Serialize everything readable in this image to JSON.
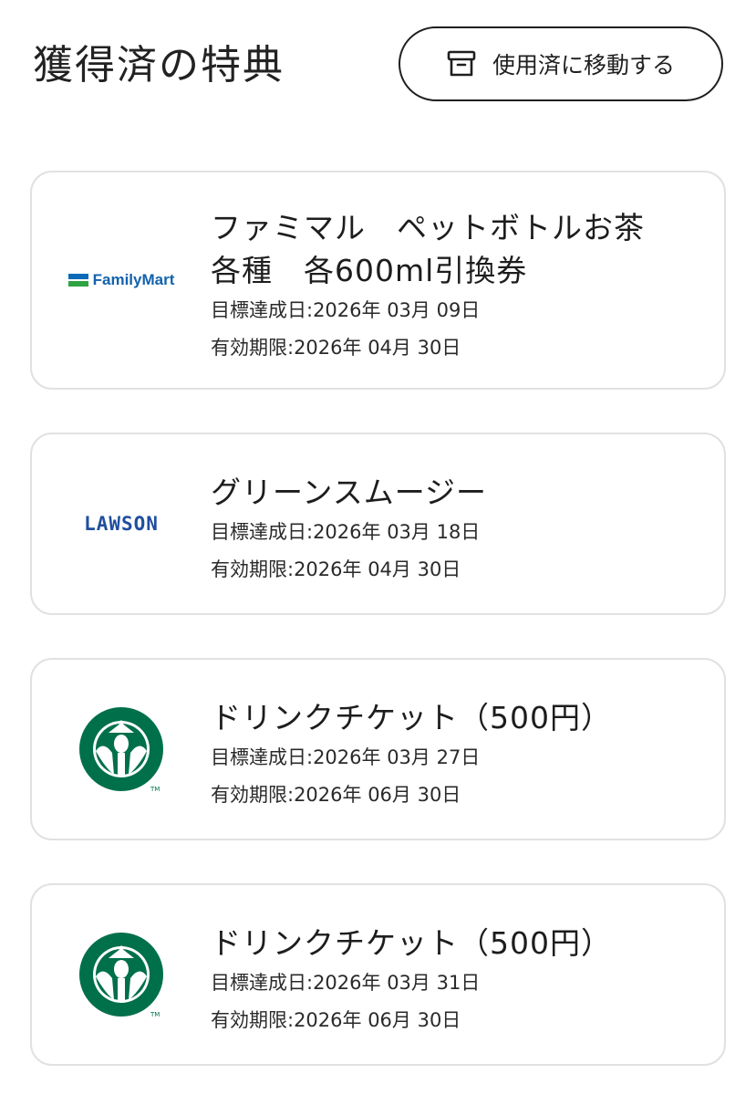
{
  "header": {
    "title": "獲得済の特典",
    "move_button_label": "使用済に移動する",
    "move_button_icon": "archive-box-icon"
  },
  "colors": {
    "card_border": "#e1e1e1",
    "familymart_blue": "#0b6bb8",
    "familymart_green": "#2ea343",
    "lawson_blue": "#1f4e9e",
    "starbucks_green": "#00704a"
  },
  "rewards": [
    {
      "brand_icon": "familymart-logo",
      "brand_text": "FamilyMart",
      "title": "ファミマル　ペットボトルお茶\n各種　各600ml引換券",
      "achieved": "目標達成日:2026年 03月 09日",
      "expiry": "有効期限:2026年 04月 30日"
    },
    {
      "brand_icon": "lawson-logo",
      "brand_text": "LAWSON",
      "title": "グリーンスムージー",
      "achieved": "目標達成日:2026年 03月 18日",
      "expiry": "有効期限:2026年 04月 30日"
    },
    {
      "brand_icon": "starbucks-logo",
      "title": "ドリンクチケット（500円）",
      "achieved": "目標達成日:2026年 03月 27日",
      "expiry": "有効期限:2026年 06月 30日"
    },
    {
      "brand_icon": "starbucks-logo",
      "title": "ドリンクチケット（500円）",
      "achieved": "目標達成日:2026年 03月 31日",
      "expiry": "有効期限:2026年 06月 30日"
    }
  ]
}
